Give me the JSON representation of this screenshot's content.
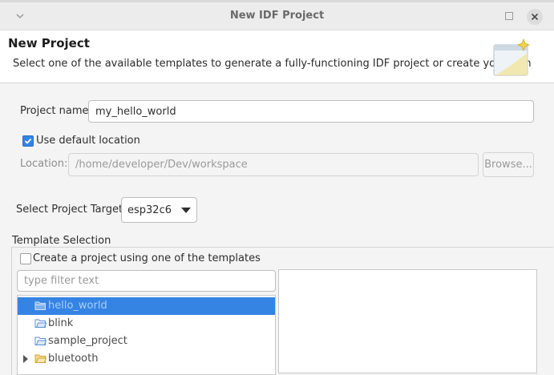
{
  "window": {
    "title": "New IDF Project"
  },
  "banner": {
    "heading": "New Project",
    "description": "Select one of the available templates to generate a fully-functioning IDF project or create your own"
  },
  "project": {
    "name_label": "Project name:",
    "name_value": "my_hello_world",
    "use_default_location_label": "Use default location",
    "use_default_location_checked": true,
    "location_label": "Location:",
    "location_value": "/home/developer/Dev/workspace",
    "browse_label": "Browse...",
    "target_label": "Select Project Target:",
    "target_value": "esp32c6"
  },
  "templates": {
    "group_title": "Template Selection",
    "use_template_label": "Create a project using one of the templates",
    "use_template_checked": false,
    "filter_placeholder": "type filter text",
    "items": [
      {
        "label": "hello_world",
        "selected": true,
        "expandable": false
      },
      {
        "label": "blink",
        "selected": false,
        "expandable": false
      },
      {
        "label": "sample_project",
        "selected": false,
        "expandable": false
      },
      {
        "label": "bluetooth",
        "selected": false,
        "expandable": true
      }
    ]
  },
  "colors": {
    "accent": "#3584e4",
    "window_background": "#f4f4f4",
    "banner_background": "#ffffff"
  },
  "icons": {
    "window_menu": "chevron-down-icon",
    "maximize": "maximize-icon",
    "close": "close-icon",
    "wizard_banner": "wizard-banner-icon",
    "combo_arrow": "caret-down-icon",
    "tree_item": "folder-icon",
    "tree_expander": "chevron-right-icon",
    "checkbox_mark": "check-icon"
  }
}
